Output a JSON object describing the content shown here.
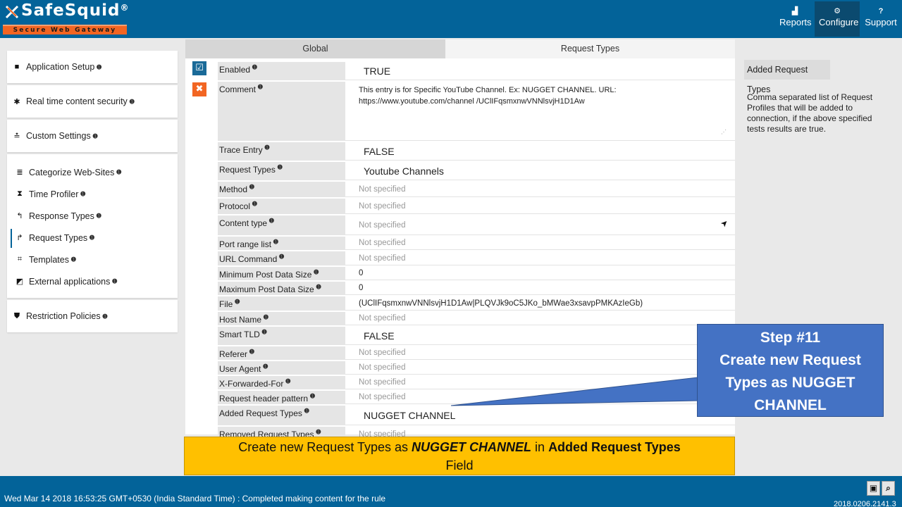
{
  "header": {
    "logo_text": "SafeSquid",
    "logo_reg": "®",
    "logo_tagline": "Secure Web Gateway",
    "nav": [
      {
        "label": "Reports",
        "icon": "chart-icon",
        "glyph": "▟",
        "active": false
      },
      {
        "label": "Configure",
        "icon": "cogs-icon",
        "glyph": "⚙",
        "active": true
      },
      {
        "label": "Support",
        "icon": "question-icon",
        "glyph": "?",
        "active": false
      }
    ]
  },
  "sidebar": {
    "info_glyph": "⓿",
    "blocks": [
      {
        "items": [
          {
            "label": "Application Setup",
            "icon": "briefcase-icon",
            "glyph": "■"
          }
        ]
      },
      {
        "items": [
          {
            "label": "Real time content security",
            "icon": "bug-icon",
            "glyph": "✱"
          }
        ]
      },
      {
        "items": [
          {
            "label": "Custom Settings",
            "icon": "sliders-icon",
            "glyph": "≛"
          }
        ]
      },
      {
        "items": [
          {
            "label": "Categorize Web-Sites",
            "icon": "database-icon",
            "glyph": "≣"
          },
          {
            "label": "Time Profiler",
            "icon": "hourglass-icon",
            "glyph": "⧗"
          },
          {
            "label": "Response Types",
            "icon": "reply-icon",
            "glyph": "↰"
          },
          {
            "label": "Request Types",
            "icon": "share-icon",
            "glyph": "↱",
            "active": true
          },
          {
            "label": "Templates",
            "icon": "object-group-icon",
            "glyph": "⌗"
          },
          {
            "label": "External applications",
            "icon": "external-link-icon",
            "glyph": "◩"
          }
        ]
      },
      {
        "items": [
          {
            "label": "Restriction Policies",
            "icon": "shield-icon",
            "glyph": "⛊"
          }
        ]
      }
    ]
  },
  "tabs": [
    {
      "label": "Global"
    },
    {
      "label": "Request Types"
    }
  ],
  "form": {
    "enable_glyph": "☑",
    "delete_glyph": "✖",
    "rows": [
      {
        "label": "Enabled",
        "value": "TRUE",
        "style": "big"
      },
      {
        "label": "Comment",
        "value": "This entry is for Specific YouTube Channel.  Ex: NUGGET CHANNEL.   URL: https://www.youtube.com/channel /UClIFqsmxnwVNNlsvjH1D1Aw",
        "style": "textarea"
      },
      {
        "label": "Trace Entry",
        "value": "FALSE",
        "style": "big"
      },
      {
        "label": "Request Types",
        "value": "Youtube Channels",
        "style": "big"
      },
      {
        "label": "Method",
        "value": "Not specified",
        "style": "placeholder"
      },
      {
        "label": "Protocol",
        "value": "Not specified",
        "style": "placeholder"
      },
      {
        "label": "Content type",
        "value": "Not specified",
        "style": "placeholder",
        "action_icon": "paper-plane-icon"
      },
      {
        "label": "Port range list",
        "value": "Not specified",
        "style": "placeholder"
      },
      {
        "label": "URL Command",
        "value": "Not specified",
        "style": "placeholder"
      },
      {
        "label": "Minimum Post Data Size",
        "value": "0",
        "style": "normal"
      },
      {
        "label": "Maximum Post Data Size",
        "value": "0",
        "style": "normal"
      },
      {
        "label": "File",
        "value": "(UClIFqsmxnwVNNlsvjH1D1Aw|PLQVJk9oC5JKo_bMWae3xsavpPMKAzIeGb)",
        "style": "normal"
      },
      {
        "label": "Host Name",
        "value": "Not specified",
        "style": "placeholder"
      },
      {
        "label": "Smart TLD",
        "value": "FALSE",
        "style": "big"
      },
      {
        "label": "Referer",
        "value": "Not specified",
        "style": "placeholder"
      },
      {
        "label": "User Agent",
        "value": "Not specified",
        "style": "placeholder"
      },
      {
        "label": "X-Forwarded-For",
        "value": "Not specified",
        "style": "placeholder"
      },
      {
        "label": "Request header pattern",
        "value": "Not specified",
        "style": "placeholder"
      },
      {
        "label": "Added Request Types",
        "value": "NUGGET CHANNEL",
        "style": "big"
      },
      {
        "label": "Removed Request Types",
        "value": "Not specified",
        "style": "placeholder"
      }
    ]
  },
  "help": {
    "title": "Added Request Types",
    "text": "Comma separated list of Request Profiles that will be added to connection, if the above specified tests results are true."
  },
  "callout": {
    "line1": "Step #11",
    "line2": "Create new Request",
    "line3": "Types as NUGGET",
    "line4": "CHANNEL",
    "color": "#4472c4"
  },
  "banner": {
    "part1": "Create new Request Types as ",
    "part2": "NUGGET CHANNEL",
    "part3": " in ",
    "part4": "Added Request Types",
    "part5": "Field",
    "color": "#ffc000"
  },
  "footer": {
    "status": "Wed Mar 14 2018 16:53:25 GMT+0530 (India Standard Time) : Completed making content for the rule",
    "save_glyph": "🖫",
    "search_glyph": "🔍",
    "version": "2018.0206.2141.3"
  },
  "colors": {
    "brand_blue": "#036399",
    "accent_orange": "#f26522"
  }
}
